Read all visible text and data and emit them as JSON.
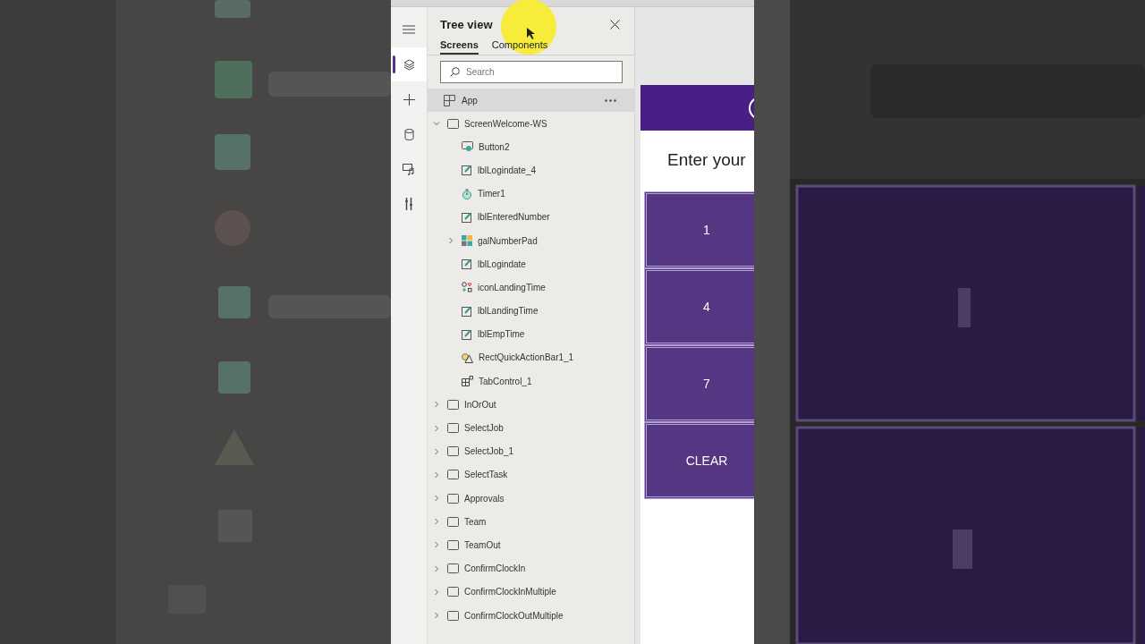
{
  "rail": [
    {
      "kind": "menu",
      "selected": false
    },
    {
      "kind": "layers",
      "selected": true
    },
    {
      "kind": "plus",
      "selected": false
    },
    {
      "kind": "database",
      "selected": false
    },
    {
      "kind": "media",
      "selected": false
    },
    {
      "kind": "tools",
      "selected": false
    }
  ],
  "tree_view": {
    "title": "Tree view",
    "tabs": [
      {
        "label": "Screens",
        "selected": true
      },
      {
        "label": "Components",
        "selected": false
      }
    ],
    "search": {
      "placeholder": "Search"
    },
    "app": {
      "label": "App",
      "selected": true
    },
    "items": [
      {
        "label": "ScreenWelcome-WS",
        "kind": "screen",
        "expanded": true,
        "children": [
          {
            "label": "Button2",
            "kind": "button"
          },
          {
            "label": "lblLogindate_4",
            "kind": "label"
          },
          {
            "label": "Timer1",
            "kind": "timer"
          },
          {
            "label": "lblEnteredNumber",
            "kind": "label"
          },
          {
            "label": "galNumberPad",
            "kind": "gallery",
            "expanded": false
          },
          {
            "label": "lblLogindate",
            "kind": "label"
          },
          {
            "label": "iconLandingTime",
            "kind": "icons"
          },
          {
            "label": "lblLandingTime",
            "kind": "label"
          },
          {
            "label": "lblEmpTime",
            "kind": "label"
          },
          {
            "label": "RectQuickActionBar1_1",
            "kind": "shapes"
          },
          {
            "label": "TabControl_1",
            "kind": "tab"
          }
        ]
      },
      {
        "label": "InOrOut",
        "kind": "screen",
        "expanded": false
      },
      {
        "label": "SelectJob",
        "kind": "screen",
        "expanded": false
      },
      {
        "label": "SelectJob_1",
        "kind": "screen",
        "expanded": false
      },
      {
        "label": "SelectTask",
        "kind": "screen",
        "expanded": false
      },
      {
        "label": "Approvals",
        "kind": "screen",
        "expanded": false
      },
      {
        "label": "Team",
        "kind": "screen",
        "expanded": false
      },
      {
        "label": "TeamOut",
        "kind": "screen",
        "expanded": false
      },
      {
        "label": "ConfirmClockIn",
        "kind": "screen",
        "expanded": false
      },
      {
        "label": "ConfirmClockInMultiple",
        "kind": "screen",
        "expanded": false
      },
      {
        "label": "ConfirmClockOutMultiple",
        "kind": "screen",
        "expanded": false
      }
    ]
  },
  "preview": {
    "heading": "Enter your",
    "keys": [
      "1",
      "4",
      "7",
      "CLEAR"
    ]
  }
}
